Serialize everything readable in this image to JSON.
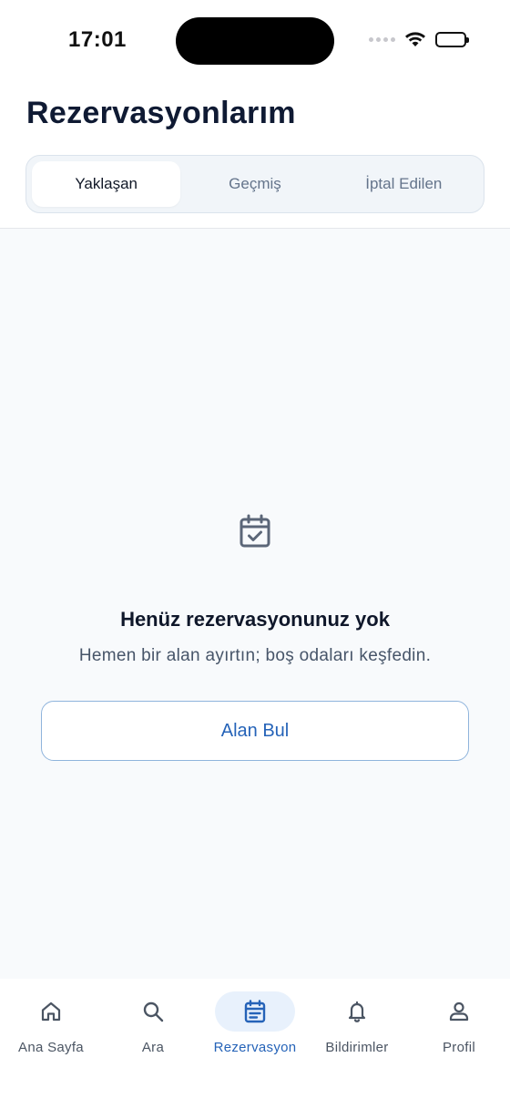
{
  "status_bar": {
    "time": "17:01"
  },
  "header": {
    "title": "Rezervasyonlarım"
  },
  "segments": [
    {
      "label": "Yaklaşan",
      "active": true
    },
    {
      "label": "Geçmiş",
      "active": false
    },
    {
      "label": "İptal Edilen",
      "active": false
    }
  ],
  "empty_state": {
    "icon": "calendar-check-icon",
    "title": "Henüz rezervasyonunuz yok",
    "subtitle": "Hemen bir alan ayırtın; boş odaları keşfedin.",
    "button_label": "Alan Bul"
  },
  "tabbar": {
    "items": [
      {
        "label": "Ana Sayfa",
        "icon": "home-icon",
        "active": false
      },
      {
        "label": "Ara",
        "icon": "search-icon",
        "active": false
      },
      {
        "label": "Rezervasyon",
        "icon": "calendar-icon",
        "active": true
      },
      {
        "label": "Bildirimler",
        "icon": "bell-icon",
        "active": false
      },
      {
        "label": "Profil",
        "icon": "person-icon",
        "active": false
      }
    ]
  },
  "colors": {
    "accent": "#2563b8",
    "accent_bg": "#e8f1fc",
    "text_primary": "#0f172a",
    "text_secondary": "#475569",
    "background": "#f8fafc"
  }
}
